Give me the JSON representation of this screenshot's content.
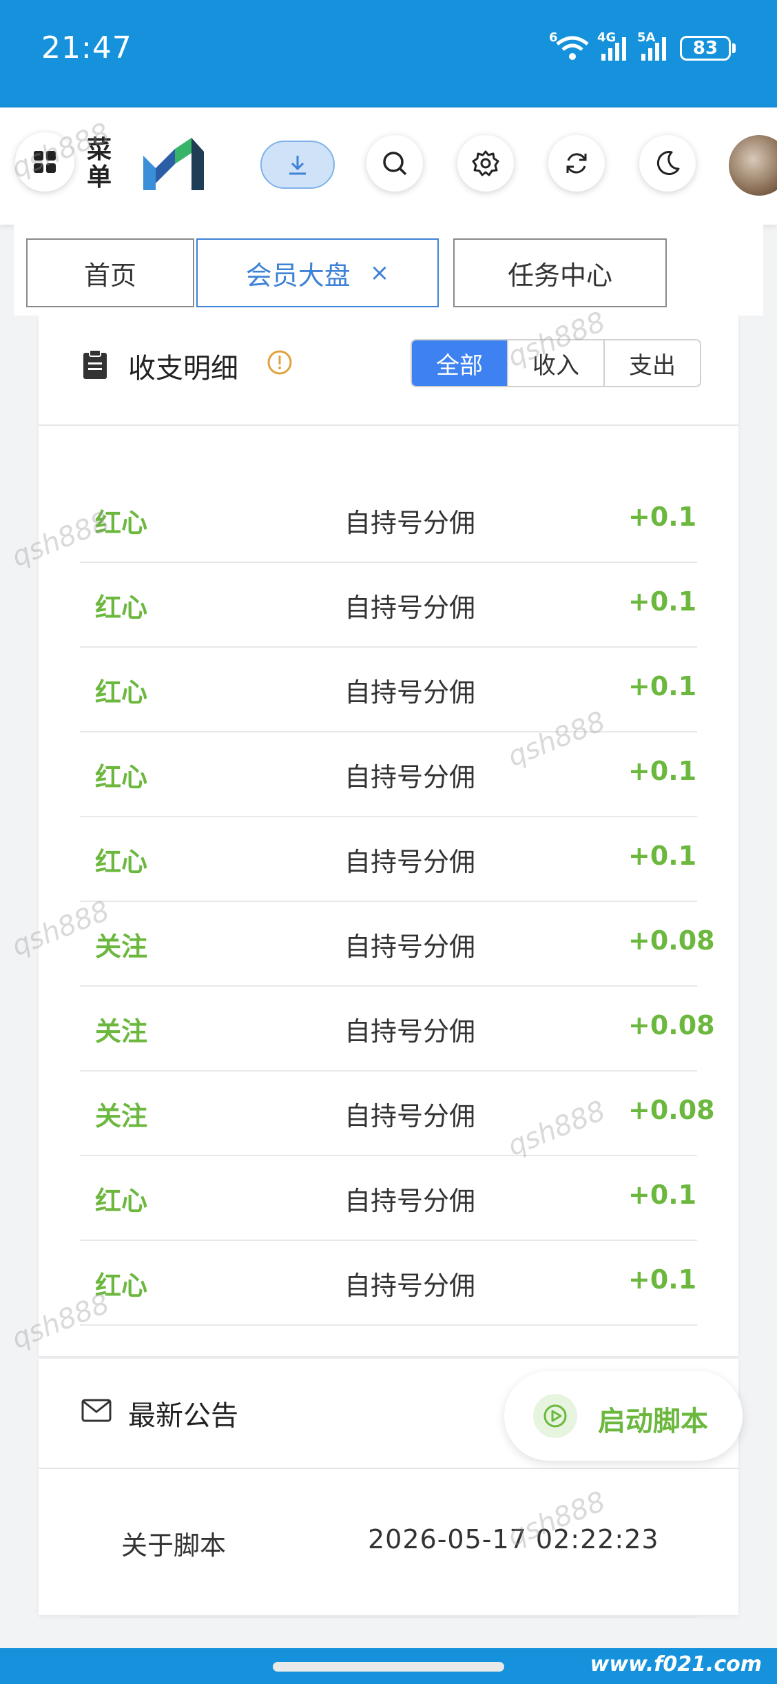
{
  "status_bar": {
    "time": "21:47",
    "network_1": "6",
    "network_2": "4G",
    "network_3": "5A",
    "battery": "83"
  },
  "header": {
    "menu_label": "菜单",
    "icons": [
      "grid-icon",
      "logo",
      "download-icon",
      "search-icon",
      "gear-icon",
      "refresh-icon",
      "moon-icon",
      "avatar"
    ]
  },
  "tabs": [
    {
      "label": "首页",
      "active": false
    },
    {
      "label": "会员大盘",
      "active": true,
      "close": "×"
    },
    {
      "label": "任务中心",
      "active": false
    }
  ],
  "ledger": {
    "title": "收支明细",
    "filters": [
      "全部",
      "收入",
      "支出"
    ],
    "active_filter": "全部",
    "rows": [
      {
        "type": "红心",
        "desc": "自持号分佣",
        "amount": "+0.1"
      },
      {
        "type": "红心",
        "desc": "自持号分佣",
        "amount": "+0.1"
      },
      {
        "type": "红心",
        "desc": "自持号分佣",
        "amount": "+0.1"
      },
      {
        "type": "红心",
        "desc": "自持号分佣",
        "amount": "+0.1"
      },
      {
        "type": "红心",
        "desc": "自持号分佣",
        "amount": "+0.1"
      },
      {
        "type": "关注",
        "desc": "自持号分佣",
        "amount": "+0.08"
      },
      {
        "type": "关注",
        "desc": "自持号分佣",
        "amount": "+0.08"
      },
      {
        "type": "关注",
        "desc": "自持号分佣",
        "amount": "+0.08"
      },
      {
        "type": "红心",
        "desc": "自持号分佣",
        "amount": "+0.1"
      },
      {
        "type": "红心",
        "desc": "自持号分佣",
        "amount": "+0.1"
      }
    ]
  },
  "notices": {
    "title": "最新公告",
    "items": [
      {
        "title": "关于脚本",
        "time": "2026-05-17 02:22:23"
      }
    ]
  },
  "fab": {
    "label": "启动脚本"
  },
  "watermark": {
    "text": "qsh888",
    "url": "www.f021.com"
  },
  "colors": {
    "status_bar": "#1592db",
    "accent_blue": "#3d82f0",
    "income_green": "#6cb83f"
  }
}
